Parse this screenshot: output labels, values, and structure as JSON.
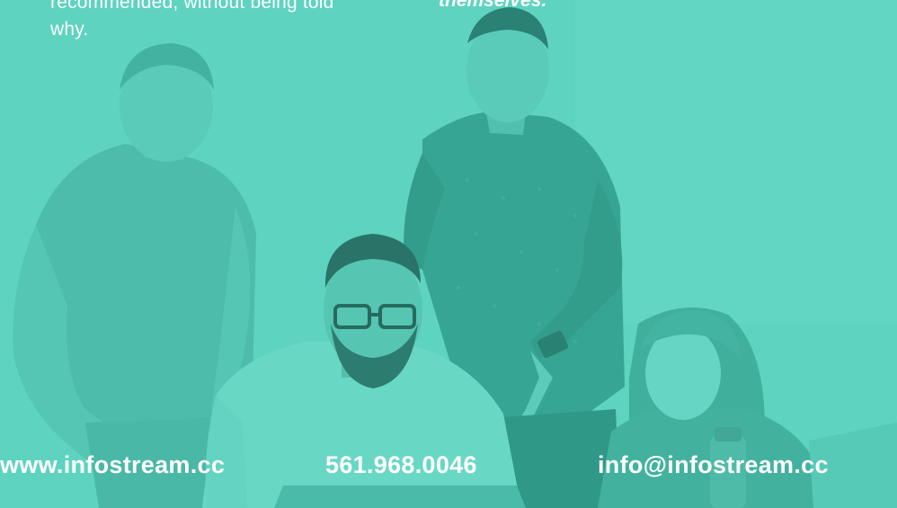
{
  "quote": {
    "left_line1": "recommended, without being told",
    "left_line2": "why.",
    "right_text": "themselves."
  },
  "footer": {
    "website": "www.infostream.cc",
    "phone": "561.968.0046",
    "email": "info@infostream.cc"
  },
  "colors": {
    "overlay_teal": "#5ed3c0",
    "text": "#ffffff"
  }
}
